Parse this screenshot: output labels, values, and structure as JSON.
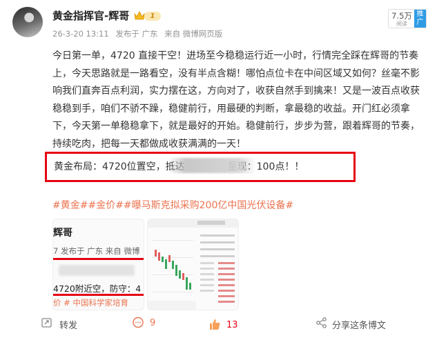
{
  "post": {
    "author": "黄金指挥官-辉哥",
    "vip_level": "1",
    "timestamp": "26-3-20 13:11",
    "published_in": "发布于 广东",
    "source": "来自 微博网页版",
    "reads": "7.5万",
    "reads_label": "阅读",
    "promote_label": "推广",
    "body": "今日第一单，4720 直接干空！进场至今稳稳运行近一小时，行情完全踩在辉哥的节奏上，今天思路就是一路看空，没有半点含糊！哪怕点位卡在中间区域又如何？丝毫不影响我们直奔百点利润，实力摆在这，方向对了，收获自然手到擒来！又是一波百点收获稳稳到手，咱们不骄不躁，稳健前行，用最硬的判断，拿最稳的收益。开门红必须拿下，今天第一单稳稳拿下，就是最好的开始。稳健前行，步步为营，跟着辉哥的节奏，持续吃肉，把每一天都做成收获满满的一天！",
    "layout_start": "黄金布局：4720位置空，抵达",
    "layout_end": "呈现：100点！！",
    "tags": "#黄金##金价##曝马斯克拟采购200亿中国光伏设备#"
  },
  "thumb1": {
    "name": "辉哥",
    "meta": "7 发布于 广东  来自 微博",
    "text": "4720附近空，防守：4",
    "tags": "价 # 中国科学家培育"
  },
  "actions": {
    "repost": "转发",
    "comments": "9",
    "likes": "13",
    "share": "分享这条博文"
  },
  "colors": {
    "accent_red": "#e60012",
    "tag_orange": "#eb7350",
    "promo_blue": "#2f9be5"
  },
  "icons": [
    "crown-icon",
    "repost-icon",
    "comment-icon",
    "like-icon",
    "share-icon"
  ]
}
